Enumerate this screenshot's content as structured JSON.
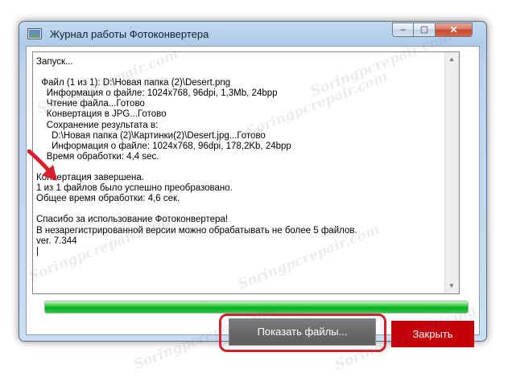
{
  "window": {
    "title": "Журнал работы Фотоконвертера",
    "min_glyph": "–",
    "max_glyph": "▢",
    "close_glyph": "✕"
  },
  "log": {
    "lines": [
      "Запуск...",
      "",
      "  Файл (1 из 1): D:\\Новая папка (2)\\Desert.png",
      "    Информация о файле: 1024x768, 96dpi, 1,3Mb, 24bpp",
      "    Чтение файла...Готово",
      "    Конвертация в JPG...Готово",
      "    Сохранение результата в:",
      "      D:\\Новая папка (2)\\Картинки(2)\\Desert.jpg...Готово",
      "      Информация о файле: 1024x768, 96dpi, 178,2Kb, 24bpp",
      "    Время обработки: 4,4 sec.",
      "",
      "Конвертация завершена.",
      "1 из 1 файлов было успешно преобразовано.",
      "Общее время обработки: 4,6 сек.",
      "",
      "Спасибо за использование Фотоконвертера!",
      "В незарегистрированной версии можно обрабатывать не более 5 файлов.",
      "ver. 7.344"
    ]
  },
  "scrollbar": {
    "up_glyph": "▲",
    "down_glyph": "▼"
  },
  "progress": {
    "percent": 100,
    "color": "#06b025"
  },
  "buttons": {
    "show_files": "Показать файлы...",
    "close": "Закрыть"
  },
  "colors": {
    "highlight": "#d81e2c",
    "close_button": "#c5000a",
    "arrow": "#d81e2c"
  },
  "watermark": "Soringpcrepair.com",
  "icons": [
    "app-icon",
    "red-arrow-icon"
  ]
}
